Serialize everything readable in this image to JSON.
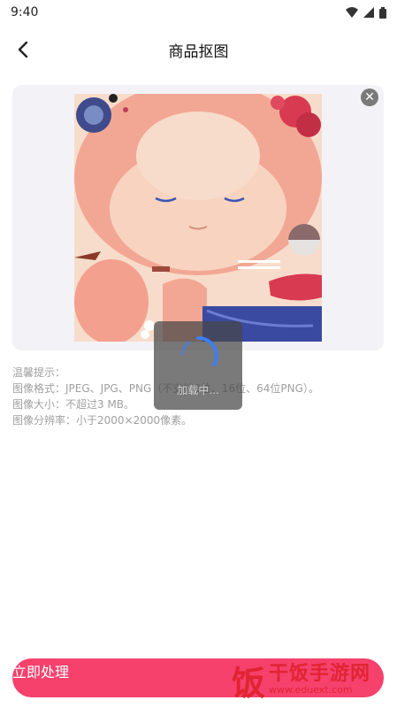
{
  "status": {
    "time": "9:40"
  },
  "header": {
    "title": "商品抠图"
  },
  "tips": {
    "heading": "温馨提示：",
    "format": "图像格式：JPEG、JPG、PNG（不支持8位、16位、64位PNG）。",
    "size": "图像大小：不超过3 MB。",
    "resolution": "图像分辨率：小于2000×2000像素。"
  },
  "loading": {
    "text": "加载中..."
  },
  "footer": {
    "process_label": "立即处理"
  },
  "watermark": {
    "title": "干饭手游网",
    "url": "www.eduext.com",
    "logo_char": "饭"
  },
  "icons": {
    "back": "chevron-left-icon",
    "close": "close-icon",
    "wifi": "wifi-icon",
    "signal": "signal-icon",
    "battery": "battery-icon"
  },
  "colors": {
    "accent": "#f5416c",
    "spinner": "#3f7ef0",
    "watermark": "#e02432"
  }
}
